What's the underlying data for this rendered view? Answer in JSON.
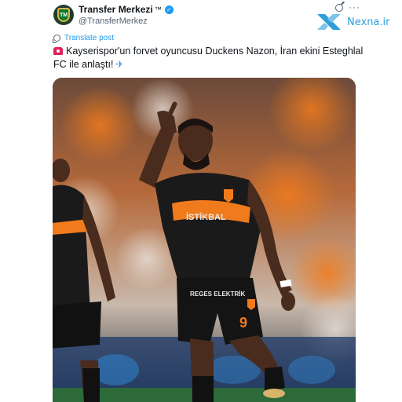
{
  "account": {
    "display_name": "Transfer Merkezi",
    "trademark": "™",
    "handle": "@TransferMerkez",
    "verified": true,
    "avatar_icon": "transfer-merkezi-shield-logo"
  },
  "header_actions": {
    "grok_icon": "grok-icon",
    "more_label": "···"
  },
  "watermark": {
    "text": "Nexna.ir",
    "color": "#2f9fd8"
  },
  "translate": {
    "label": "Translate post"
  },
  "tweet": {
    "text": "Kayserispor'un forvet oyuncusu Duckens Nazon, İran ekini Esteghlal FC ile anlaştı!",
    "leading_emoji": "siren-icon",
    "trailing_emoji": "airplane-icon"
  },
  "media": {
    "description_icon": "football-player-photo",
    "shirt_number": "9",
    "sponsor_chest": "İSTİKBAL",
    "sponsor_shorts": "REGES ELEKTRİK",
    "accent_color": "#f07b1d"
  }
}
